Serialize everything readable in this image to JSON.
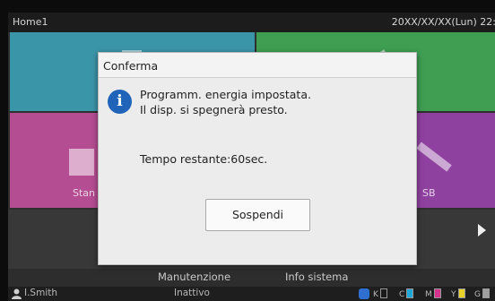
{
  "topbar": {
    "title": "Home1",
    "datetime": "20XX/XX/XX(Lun) 22:2"
  },
  "tiles": {
    "left_label": "Stan",
    "right_label": "SB"
  },
  "menu": {
    "item1": "Manutenzione",
    "item2": "Info sistema"
  },
  "statusbar": {
    "user": "I.Smith",
    "state": "Inattivo",
    "inks": [
      {
        "label": "K",
        "color": "#1a1a1a"
      },
      {
        "label": "C",
        "color": "#1fa7d8"
      },
      {
        "label": "M",
        "color": "#d4328c"
      },
      {
        "label": "Y",
        "color": "#e8d22a"
      },
      {
        "label": "G",
        "color": "#a0a0a0"
      }
    ]
  },
  "dialog": {
    "title": "Conferma",
    "message_line1": "Programm. energia impostata.",
    "message_line2": "Il disp. si spegnerà presto.",
    "remaining": "Tempo restante:60sec.",
    "button_label": "Sospendi"
  },
  "colors": {
    "info_icon": "#1f64b8",
    "tile_teal": "#3b95a8",
    "tile_green": "#3f9e52",
    "tile_magenta": "#b54d92",
    "tile_purple": "#8f41a0"
  }
}
